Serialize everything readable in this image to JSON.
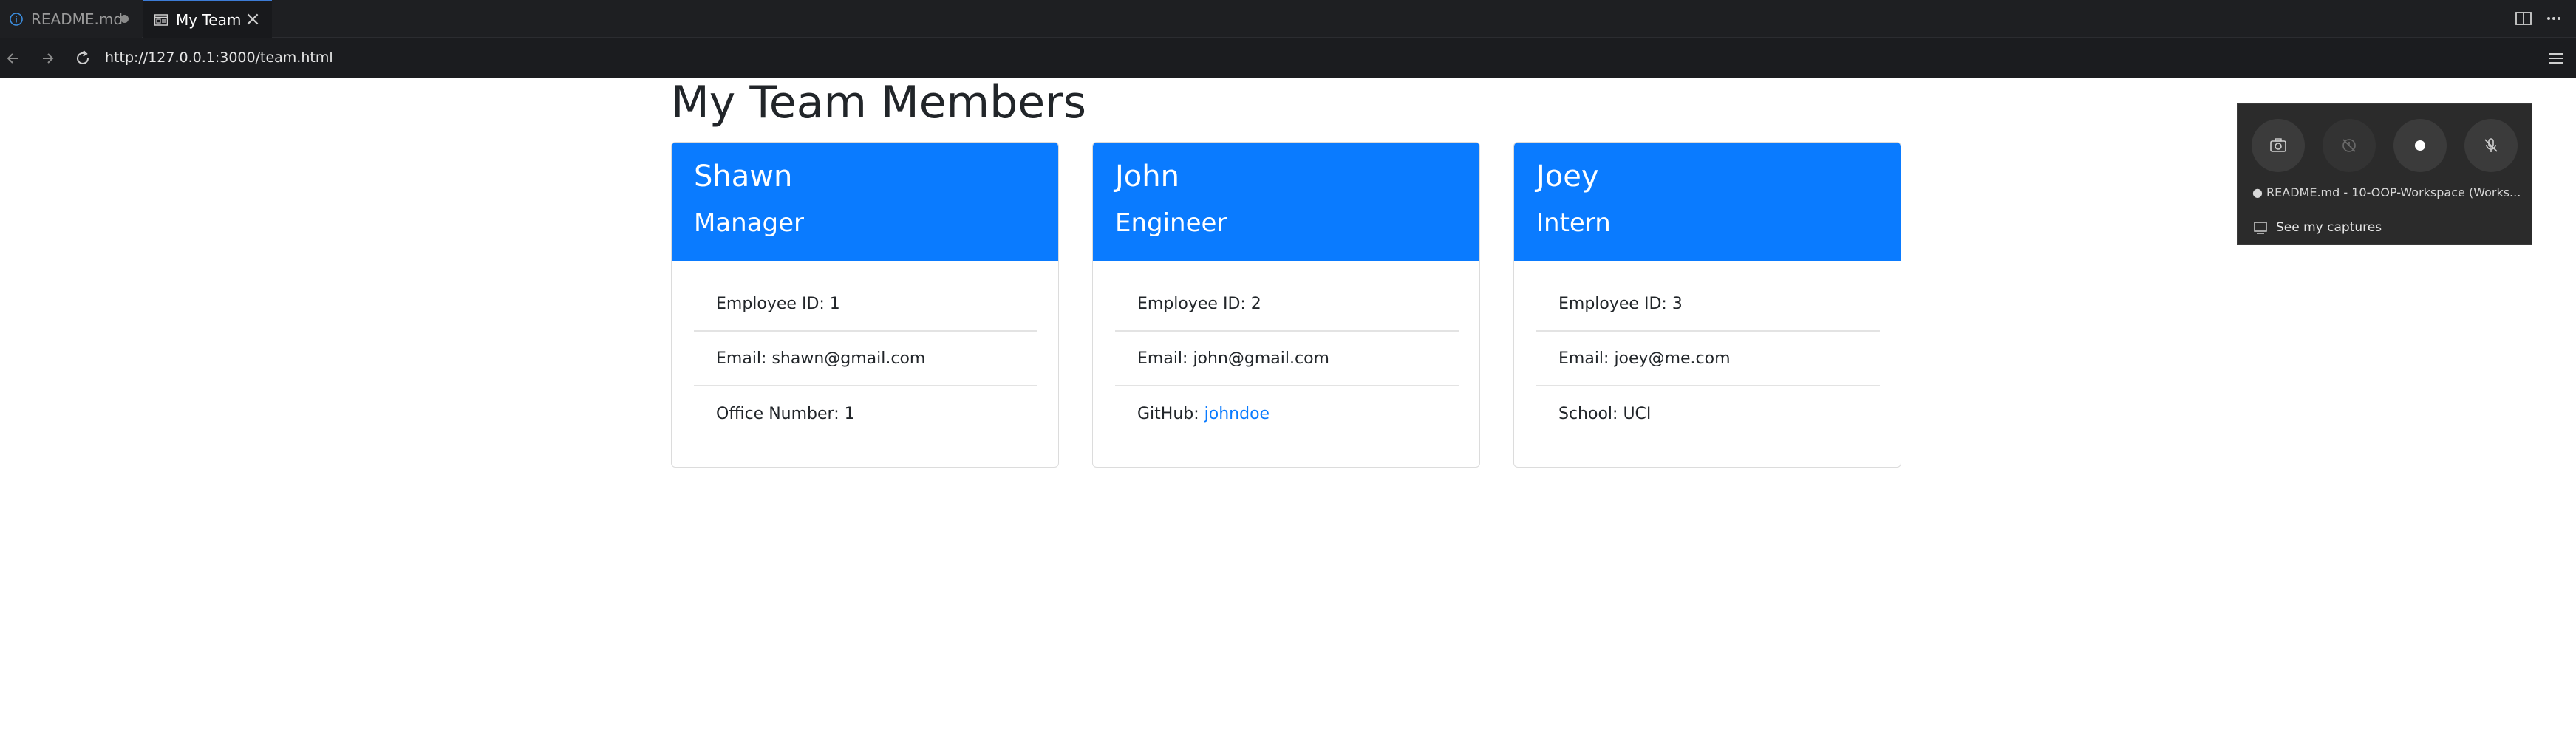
{
  "tabs": [
    {
      "label": "README.md",
      "icon": "info-icon",
      "modified": true
    },
    {
      "label": "My Team",
      "icon": "preview-icon",
      "active": true
    }
  ],
  "address_bar": {
    "url": "http://127.0.0.1:3000/team.html"
  },
  "page": {
    "title": "My Team Members",
    "members": [
      {
        "name": "Shawn",
        "role": "Manager",
        "id_label": "Employee ID: 1",
        "email_label": "Email: shawn@gmail.com",
        "extra_label": "Office Number: 1"
      },
      {
        "name": "John",
        "role": "Engineer",
        "id_label": "Employee ID: 2",
        "email_label": "Email: john@gmail.com",
        "extra_prefix": "GitHub: ",
        "extra_link": "johndoe"
      },
      {
        "name": "Joey",
        "role": "Intern",
        "id_label": "Employee ID: 3",
        "email_label": "Email: joey@me.com",
        "extra_label": "School: UCI"
      }
    ]
  },
  "capture_overlay": {
    "status": "● README.md - 10-OOP-Workspace (Works...",
    "link": "See my captures"
  },
  "colors": {
    "accent": "#0a7bff",
    "chrome_bg": "#1e1f22",
    "text": "#212529"
  }
}
